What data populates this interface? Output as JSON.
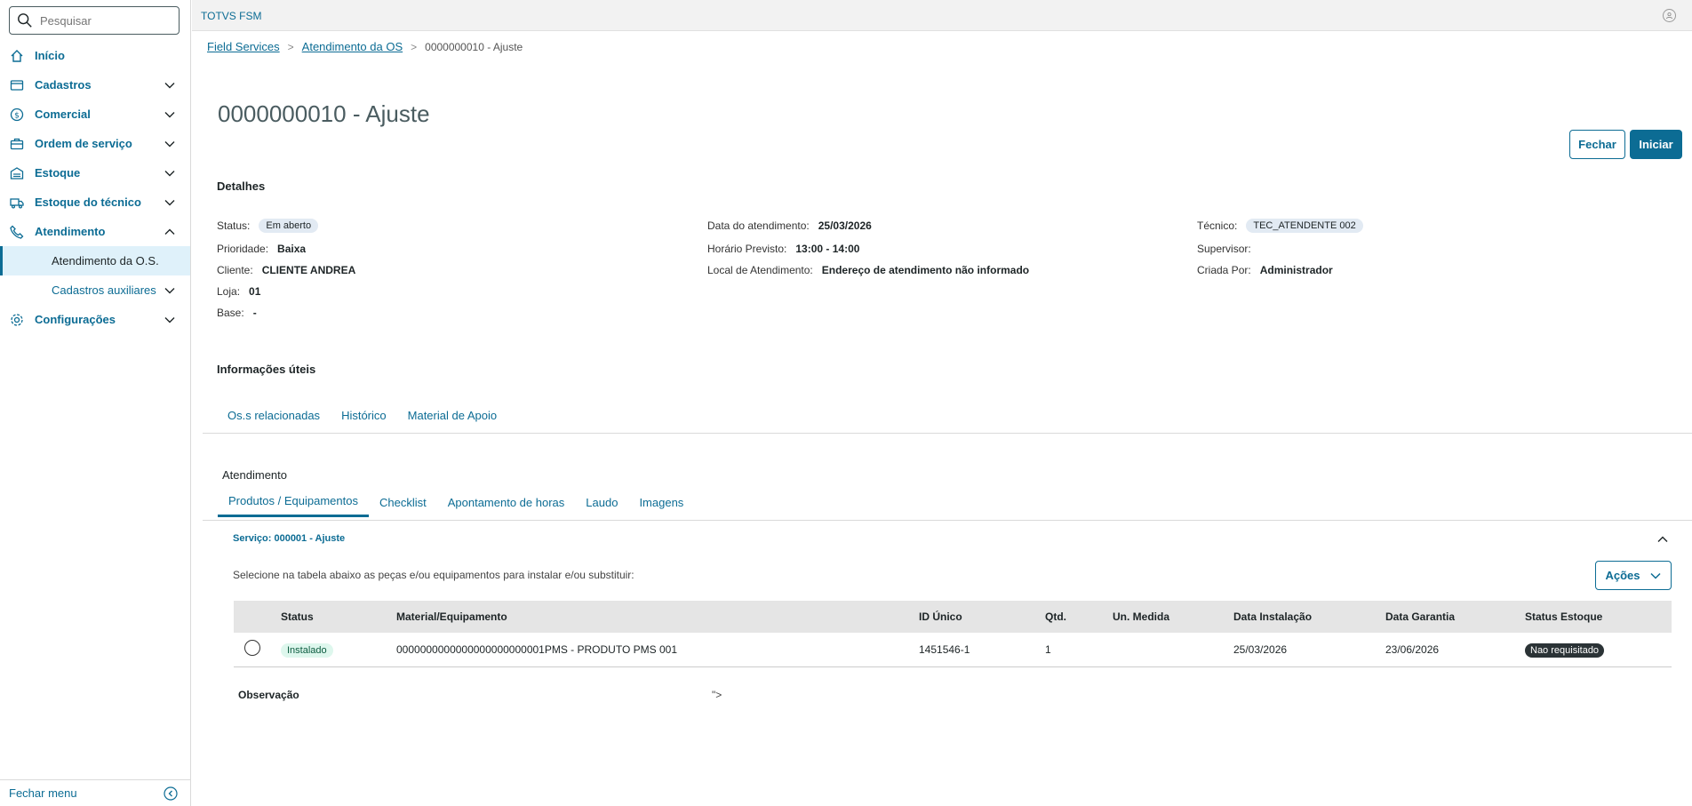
{
  "search": {
    "placeholder": "Pesquisar"
  },
  "sidebar": {
    "items": [
      {
        "label": "Início",
        "icon": "home-icon"
      },
      {
        "label": "Cadastros",
        "icon": "card-icon"
      },
      {
        "label": "Comercial",
        "icon": "dollar-icon"
      },
      {
        "label": "Ordem de serviço",
        "icon": "briefcase-icon"
      },
      {
        "label": "Estoque",
        "icon": "warehouse-icon"
      },
      {
        "label": "Estoque do técnico",
        "icon": "truck-icon"
      },
      {
        "label": "Atendimento",
        "icon": "phone-icon"
      },
      {
        "label": "Atendimento da O.S."
      },
      {
        "label": "Cadastros auxiliares"
      },
      {
        "label": "Configurações",
        "icon": "gear-icon"
      }
    ],
    "footer_label": "Fechar menu"
  },
  "header": {
    "brand": "TOTVS FSM"
  },
  "breadcrumb": {
    "items": [
      "Field Services",
      "Atendimento da OS"
    ],
    "current": "0000000010 - Ajuste"
  },
  "page": {
    "title": "0000000010 - Ajuste",
    "btn_fechar": "Fechar",
    "btn_iniciar": "Iniciar"
  },
  "details": {
    "title": "Detalhes",
    "status_k": "Status:",
    "status_v": "Em aberto",
    "prioridade_k": "Prioridade:",
    "prioridade_v": "Baixa",
    "cliente_k": "Cliente:",
    "cliente_v": "CLIENTE ANDREA",
    "loja_k": "Loja:",
    "loja_v": "01",
    "base_k": "Base:",
    "base_v": "-",
    "data_k": "Data do atendimento:",
    "data_v": "25/03/2026",
    "horario_k": "Horário Previsto:",
    "horario_v": "13:00 - 14:00",
    "local_k": "Local de Atendimento:",
    "local_v": "Endereço de atendimento não informado",
    "tecnico_k": "Técnico:",
    "tecnico_v": "TEC_ATENDENTE 002",
    "supervisor_k": "Supervisor:",
    "criada_k": "Criada Por:",
    "criada_v": "Administrador"
  },
  "info": {
    "title": "Informações úteis",
    "tabs": [
      "Os.s relacionadas",
      "Histórico",
      "Material de Apoio"
    ]
  },
  "atendimento": {
    "title": "Atendimento",
    "tabs": [
      "Produtos / Equipamentos",
      "Checklist",
      "Apontamento de horas",
      "Laudo",
      "Imagens"
    ],
    "servico": "Serviço: 000001 - Ajuste",
    "hint": "Selecione na tabela abaixo as peças e/ou equipamentos para instalar e/ou substituir:",
    "acoes": "Ações"
  },
  "table": {
    "headers": [
      "Status",
      "Material/Equipamento",
      "ID Único",
      "Qtd.",
      "Un. Medida",
      "Data Instalação",
      "Data Garantia",
      "Status Estoque"
    ],
    "rows": [
      {
        "status": "Instalado",
        "material": "0000000000000000000000001PMS - PRODUTO PMS 001",
        "id": "1451546-1",
        "qtd": "1",
        "un": "",
        "data_inst": "25/03/2026",
        "data_gar": "23/06/2026",
        "estoque": "Nao requisitado"
      }
    ]
  },
  "observacao": {
    "label": "Observação",
    "value": "\">"
  }
}
